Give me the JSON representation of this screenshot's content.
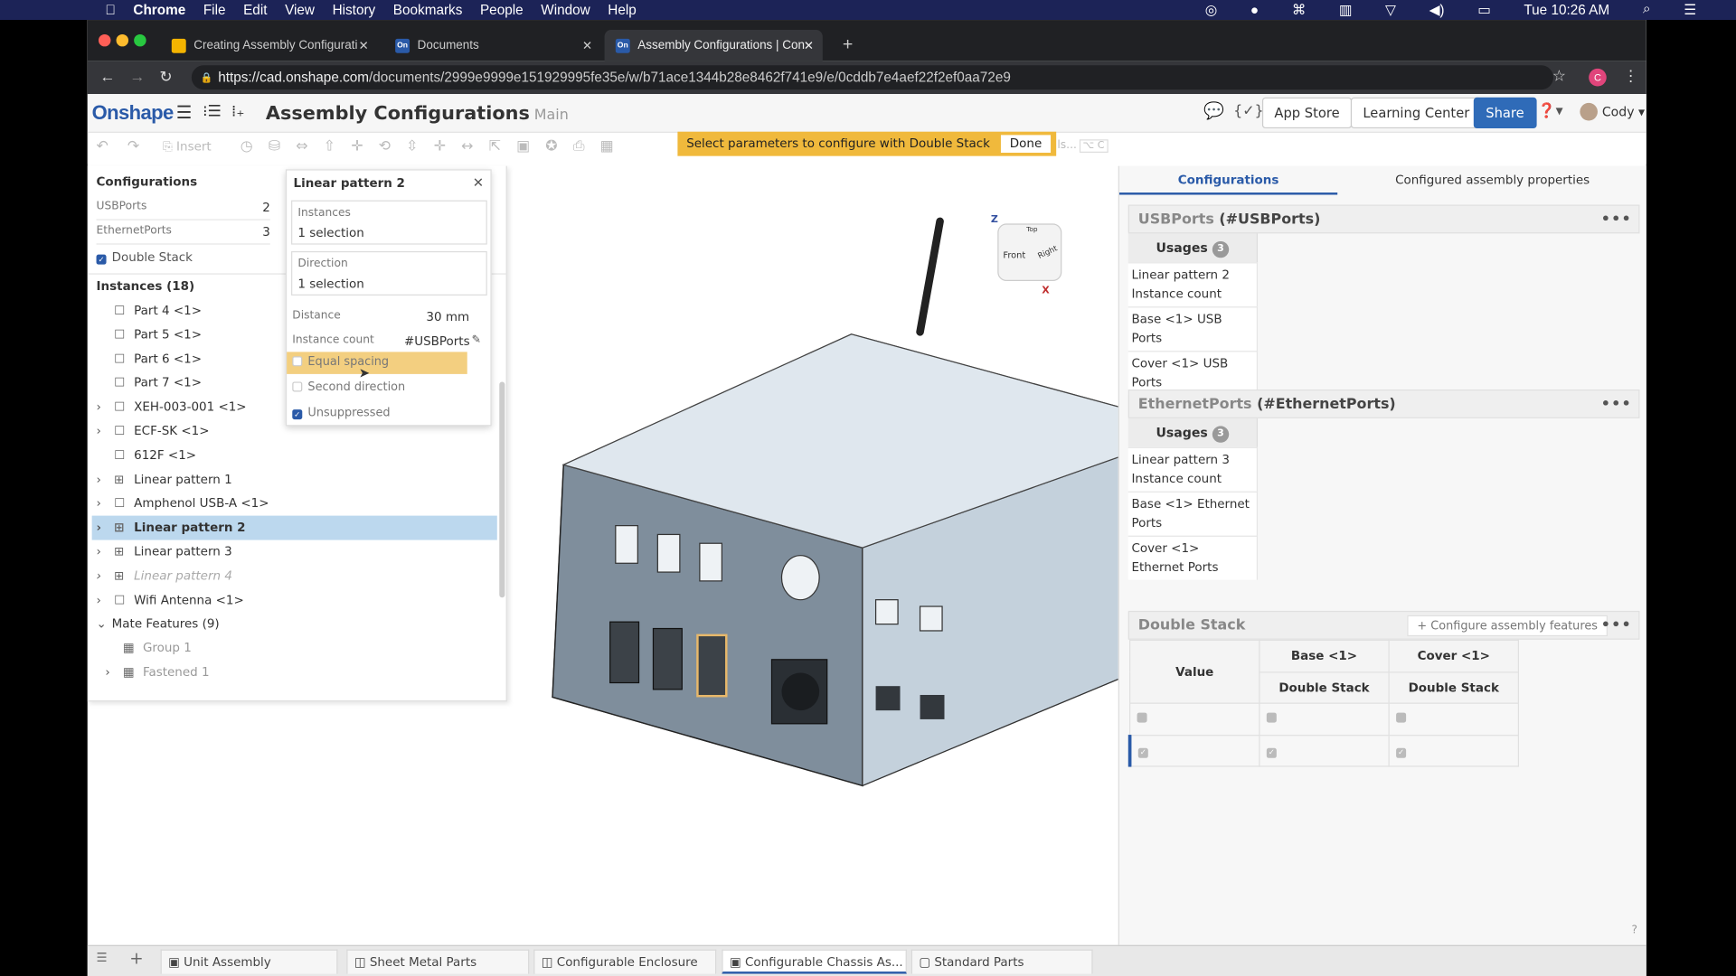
{
  "menubar": {
    "apple": "",
    "app": "Chrome",
    "items": [
      "File",
      "Edit",
      "View",
      "History",
      "Bookmarks",
      "People",
      "Window",
      "Help"
    ],
    "clock": "Tue 10:26 AM"
  },
  "browser": {
    "tabs": [
      {
        "label": "Creating Assembly Configurati",
        "fav": ""
      },
      {
        "label": "Documents",
        "fav": "On"
      },
      {
        "label": "Assembly Configurations | Con",
        "fav": "On"
      }
    ],
    "url_host": "https://cad.onshape.com",
    "url_path": "/documents/2999e9999e151929995fe35e/w/b71ace1344b28e8462f741e9/e/0cddb7e4aef22f2ef0aa72e9",
    "profile": "C"
  },
  "header": {
    "logo": "Onshape",
    "title": "Assembly Configurations",
    "branch": "Main",
    "app_store": "App Store",
    "learning_center": "Learning Center",
    "share": "Share",
    "user": "Cody"
  },
  "toolbar": {
    "insert": "Insert",
    "hint": "ls...",
    "shortcut": "⌥ C"
  },
  "banner": {
    "text": "Select parameters to configure with Double Stack",
    "done": "Done"
  },
  "configurations": {
    "title": "Configurations",
    "params": [
      {
        "name": "USBPorts",
        "value": "2"
      },
      {
        "name": "EthernetPorts",
        "value": "3"
      }
    ],
    "double_stack": "Double Stack"
  },
  "instances": {
    "title": "Instances (18)",
    "items": [
      {
        "label": "Part 4 <1>",
        "chev": false,
        "icon": "part"
      },
      {
        "label": "Part 5 <1>",
        "chev": false,
        "icon": "part"
      },
      {
        "label": "Part 6 <1>",
        "chev": false,
        "icon": "part"
      },
      {
        "label": "Part 7 <1>",
        "chev": false,
        "icon": "part"
      },
      {
        "label": "XEH-003-001 <1>",
        "chev": true,
        "icon": "part"
      },
      {
        "label": "ECF-SK <1>",
        "chev": true,
        "icon": "part"
      },
      {
        "label": "612F <1>",
        "chev": false,
        "icon": "part"
      },
      {
        "label": "Linear pattern 1",
        "chev": true,
        "icon": "pattern"
      },
      {
        "label": "Amphenol USB-A <1>",
        "chev": true,
        "icon": "part"
      },
      {
        "label": "Linear pattern 2",
        "chev": true,
        "icon": "pattern",
        "selected": true
      },
      {
        "label": "Linear pattern 3",
        "chev": true,
        "icon": "pattern"
      },
      {
        "label": "Linear pattern 4",
        "chev": true,
        "icon": "pattern",
        "suppressed": true
      },
      {
        "label": "Wifi Antenna <1>",
        "chev": true,
        "icon": "part"
      }
    ],
    "mate_title": "Mate Features (9)",
    "mates": [
      {
        "label": "Group 1",
        "chev": false
      },
      {
        "label": "Fastened 1",
        "chev": true
      }
    ]
  },
  "dialog": {
    "title": "Linear pattern 2",
    "instances_label": "Instances",
    "instances_value": "1 selection",
    "direction_label": "Direction",
    "direction_value": "1 selection",
    "distance_label": "Distance",
    "distance_value": "30 mm",
    "count_label": "Instance count",
    "count_value": "#USBPorts",
    "equal_spacing": "Equal spacing",
    "second_direction": "Second direction",
    "unsuppressed": "Unsuppressed"
  },
  "viewcube": {
    "front": "Front",
    "right": "Right",
    "top": "Top",
    "z": "Z",
    "x": "X"
  },
  "right": {
    "tabs": [
      "Configurations",
      "Configured assembly properties"
    ],
    "usage_label": "Usages",
    "usb": {
      "name": "USBPorts",
      "id": "(#USBPorts)",
      "count": "3",
      "usages": [
        "Linear pattern 2 Instance count",
        "Base <1> USB Ports",
        "Cover <1> USB Ports"
      ]
    },
    "eth": {
      "name": "EthernetPorts",
      "id": "(#EthernetPorts)",
      "count": "3",
      "usages": [
        "Linear pattern 3 Instance count",
        "Base <1> Ethernet Ports",
        "Cover <1> Ethernet Ports"
      ]
    },
    "ds": {
      "name": "Double Stack",
      "configure": "Configure assembly features",
      "value_col": "Value",
      "cols": [
        "Base <1>",
        "Cover <1>"
      ],
      "sub": "Double Stack",
      "rows": [
        false,
        true
      ]
    }
  },
  "bottom_tabs": [
    "Unit Assembly",
    "Sheet Metal Parts",
    "Configurable Enclosure",
    "Configurable Chassis As...",
    "Standard Parts"
  ],
  "colors": {
    "accent": "#2a5aa8",
    "banner": "#f0b93c",
    "selection": "#bcd8ee"
  }
}
